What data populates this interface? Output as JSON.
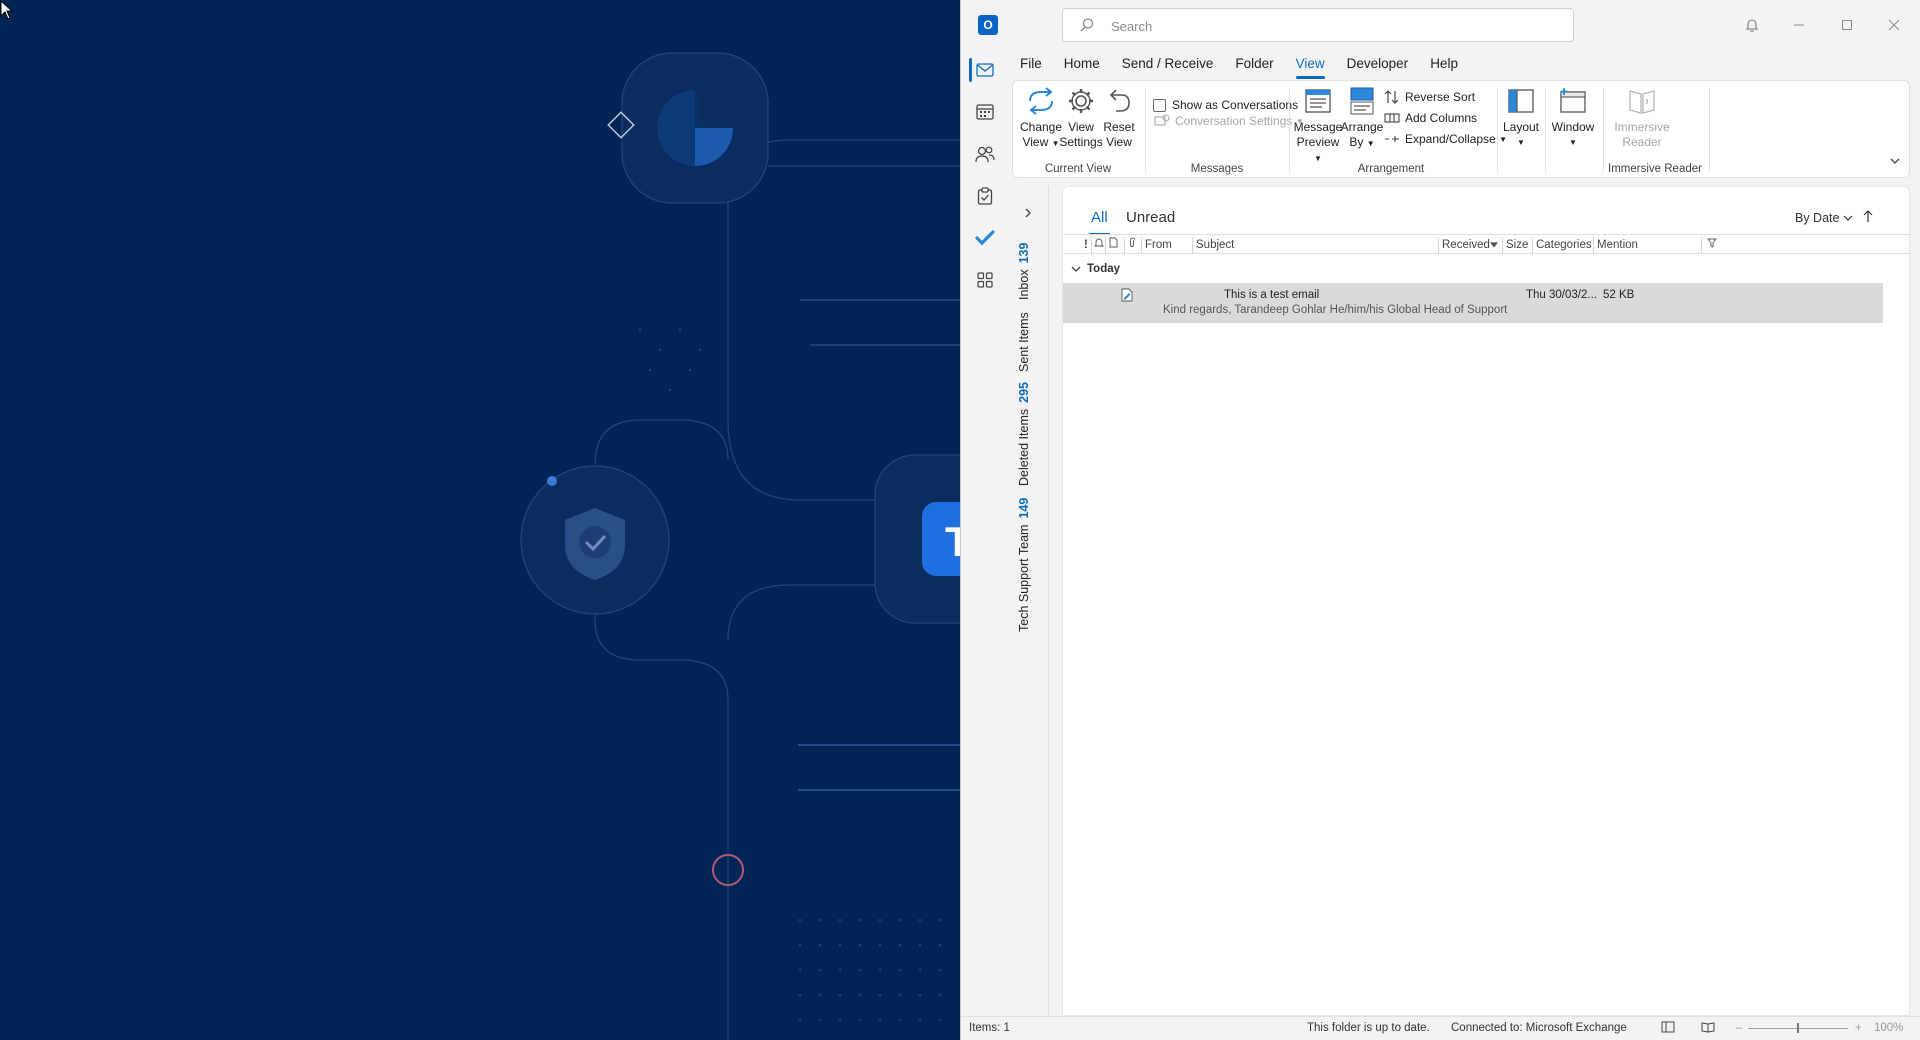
{
  "window": {
    "app_name": "Outlook",
    "search_placeholder": "Search"
  },
  "menu": {
    "tabs": [
      "File",
      "Home",
      "Send / Receive",
      "Folder",
      "View",
      "Developer",
      "Help"
    ],
    "active": "View"
  },
  "ribbon": {
    "change_view": "Change View",
    "view_settings_1": "View",
    "view_settings_2": "Settings",
    "reset_view_1": "Reset",
    "reset_view_2": "View",
    "change_view_1": "Change",
    "change_view_2": "View",
    "show_as_conversations": "Show as Conversations",
    "conversation_settings": "Conversation Settings",
    "message_preview_1": "Message",
    "message_preview_2": "Preview",
    "arrange_by_1": "Arrange",
    "arrange_by_2": "By",
    "reverse_sort": "Reverse Sort",
    "add_columns": "Add Columns",
    "expand_collapse": "Expand/Collapse",
    "layout": "Layout",
    "window": "Window",
    "immersive_reader_1": "Immersive",
    "immersive_reader_2": "Reader",
    "groups": {
      "current_view": "Current View",
      "messages": "Messages",
      "arrangement": "Arrangement",
      "immersive_reader": "Immersive Reader"
    }
  },
  "folders": [
    {
      "name": "Inbox",
      "count": "139"
    },
    {
      "name": "Sent Items",
      "count": ""
    },
    {
      "name": "Deleted Items",
      "count": "295"
    },
    {
      "name": "Tech Support Team",
      "count": "149"
    }
  ],
  "message_list": {
    "filter_all": "All",
    "filter_unread": "Unread",
    "sort_by": "By Date",
    "columns": {
      "importance": "!",
      "from": "From",
      "subject": "Subject",
      "received": "Received",
      "size": "Size",
      "categories": "Categories",
      "mention": "Mention"
    },
    "group": "Today",
    "messages": [
      {
        "subject": "This is a test email",
        "preview": "Kind regards,  Tarandeep Gohlar He/him/his  Global Head of Support",
        "received": "Thu 30/03/2...",
        "size": "52 KB"
      }
    ]
  },
  "status": {
    "items": "Items: 1",
    "folder_status": "This folder is up to date.",
    "connection": "Connected to: Microsoft Exchange",
    "zoom": "100%"
  },
  "colors": {
    "accent": "#0f6cbd",
    "desktop_bg": "#012456"
  }
}
